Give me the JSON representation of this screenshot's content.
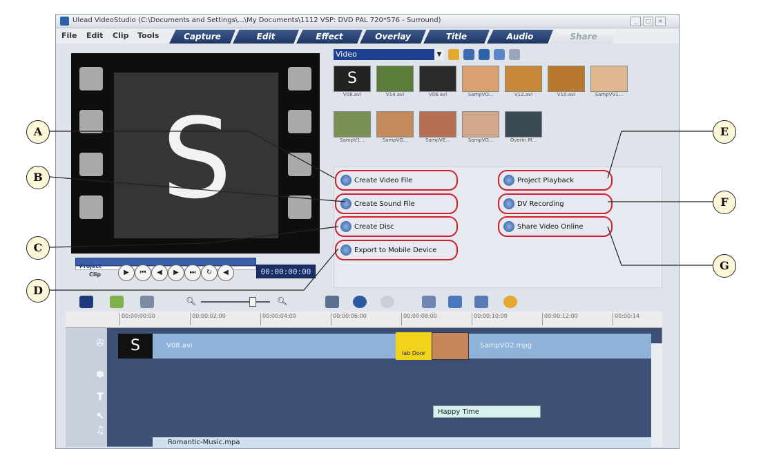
{
  "window": {
    "title": "Ulead VideoStudio (C:\\Documents and Settings\\...\\My Documents\\1112 VSP: DVD PAL 720*576 - Surround)",
    "controls": [
      "_",
      "□",
      "×"
    ]
  },
  "menu": [
    "File",
    "Edit",
    "Clip",
    "Tools"
  ],
  "tabs": [
    {
      "label": "Capture"
    },
    {
      "label": "Edit"
    },
    {
      "label": "Effect"
    },
    {
      "label": "Overlay"
    },
    {
      "label": "Title"
    },
    {
      "label": "Audio"
    },
    {
      "label": "Share"
    }
  ],
  "preview": {
    "frame_glyph": "S"
  },
  "player": {
    "project_label": "Project",
    "clip_label": "Clip",
    "timecode": "00:00:00:00",
    "buttons": [
      "play-icon",
      "home-icon",
      "prev-frame-icon",
      "next-frame-icon",
      "end-icon",
      "repeat-icon",
      "volume-icon"
    ]
  },
  "library": {
    "category": "Video",
    "thumbnails": [
      {
        "caption": "V08.avi",
        "color": "#222222",
        "glyph": "S"
      },
      {
        "caption": "V14.avi",
        "color": "#5c7d3a"
      },
      {
        "caption": "V08.avi",
        "color": "#2a2a2a"
      },
      {
        "caption": "SampVO...",
        "color": "#d9a070"
      },
      {
        "caption": "V12.avi",
        "color": "#c78a3c"
      },
      {
        "caption": "V10.avi",
        "color": "#b9782e"
      },
      {
        "caption": "SampVV1...",
        "color": "#e0b890"
      },
      {
        "caption": "SampV1...",
        "color": "#7a8f52"
      },
      {
        "caption": "SampVO...",
        "color": "#c48a5c"
      },
      {
        "caption": "SampVE...",
        "color": "#b46e50"
      },
      {
        "caption": "SampVO...",
        "color": "#d2a88c"
      },
      {
        "caption": "Overin M...",
        "color": "#3a4a55"
      }
    ]
  },
  "share": {
    "buttons": [
      {
        "label": "Create Video File"
      },
      {
        "label": "Create Sound File"
      },
      {
        "label": "Create Disc"
      },
      {
        "label": "Export to Mobile Device"
      },
      {
        "label": "Project Playback"
      },
      {
        "label": "DV Recording"
      },
      {
        "label": "Share Video Online"
      }
    ]
  },
  "timeline": {
    "ticks": [
      "00:00:00:00",
      "00:00:02:00",
      "00:00:04:00",
      "00:00:06:00",
      "00:00:08:00",
      "00:00:10:00",
      "00:00:12:00",
      "00:00:14"
    ],
    "video_clip": "V08.avi",
    "video_clip2": "SampVO2.mpg",
    "transition_label": "lab Door",
    "title_clip": "Happy Time",
    "music_clip": "Romantic-Music.mpa"
  },
  "callouts": [
    "A",
    "B",
    "C",
    "D",
    "E",
    "F",
    "G"
  ],
  "colors": {
    "callout_ring": "#d21f2a",
    "tab_bg": "#1e3563",
    "timeline_bg": "#3c4f75"
  }
}
